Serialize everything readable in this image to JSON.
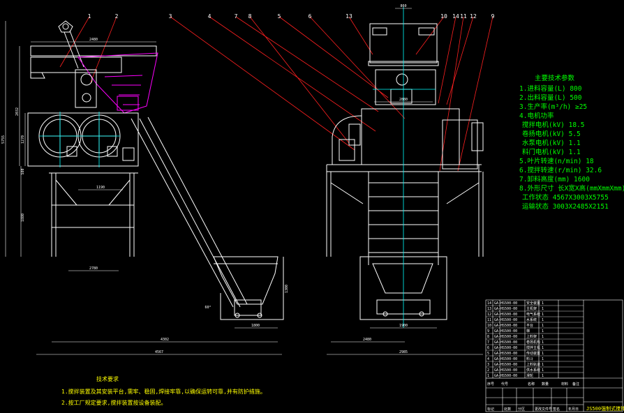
{
  "colors": {
    "background": "#000000",
    "outline": "#ffffff",
    "hidden": "#00ffff",
    "leader": "#ff2020",
    "hopper": "#ff00ff",
    "dimension": "#ffffff",
    "spec_text": "#00ff00",
    "note_text": "#ffff00"
  },
  "balloons": [
    "1",
    "2",
    "3",
    "4",
    "7",
    "8",
    "5",
    "6",
    "13",
    "10",
    "14",
    "11",
    "12",
    "9"
  ],
  "dimensions": {
    "hopper_width": "2480",
    "height_total": "5755",
    "height_upper": "2032",
    "mixer_height": "1270",
    "base_height": "1880",
    "stand_gap": "580",
    "mixer_span": "1190",
    "leg_span": "2780",
    "skip_height": "1300",
    "skip_width": "1800",
    "front_width_a": "4302",
    "front_width_total": "4567",
    "side_top": "860",
    "side_mid": "2880",
    "side_frame": "1900",
    "side_base": "2480",
    "side_total": "2985",
    "angle_label": "60°"
  },
  "specs": {
    "title": "主要技术参数",
    "lines": [
      "1.进料容量(L)  800",
      "2.出料容量(L)  500",
      "3.生产率(m³/h)  ≥25",
      "4.电机功率",
      "搅拌电机(kV)  18.5",
      "卷扬电机(kV)  5.5",
      "水泵电机(kV)  1.1",
      "料门电机(kV)  1.1",
      "5.叶片转速(n/min)  18",
      "6.搅拌转速(r/min)  32.6",
      "7.卸料高度(mm)    1600",
      "8.外形尺寸 长X宽X高(mmXmmXmm)",
      "工作状态  4567X3003X5755",
      "运输状态  3003X2485X2151"
    ]
  },
  "notes": {
    "title": "技术要求",
    "lines": [
      "1.搅拌装置及其安装平台,需牢、稳固,焊接牢靠,以确保运转可靠,并有防护措施。",
      "2.按工厂规定要求,搅拌装置按设备装配。"
    ]
  },
  "title_block": {
    "drawing_title": "JS500强制式搅拌机总图",
    "headers": [
      "序号",
      "代号",
      "名称",
      "数量",
      "材料",
      "备注"
    ],
    "rows": [
      {
        "no": "14",
        "code": "GA-HS500-00",
        "name": "安全装置",
        "qty": "1"
      },
      {
        "no": "13",
        "code": "GA-HS500-00",
        "name": "主机架",
        "qty": "1"
      },
      {
        "no": "12",
        "code": "GA-HS500-00",
        "name": "电气系统",
        "qty": "1"
      },
      {
        "no": "11",
        "code": "GA-HS500-00",
        "name": "水系统",
        "qty": "1"
      },
      {
        "no": "10",
        "code": "GA-HS500-00",
        "name": "平台",
        "qty": "1"
      },
      {
        "no": "9",
        "code": "GA-HS500-00",
        "name": "梯",
        "qty": "1"
      },
      {
        "no": "8",
        "code": "GA-HS500-00",
        "name": "上料架",
        "qty": "1"
      },
      {
        "no": "7",
        "code": "GA-HS500-00",
        "name": "卷扬机构",
        "qty": "1"
      },
      {
        "no": "6",
        "code": "GA-HS500-00",
        "name": "搅拌主机",
        "qty": "1"
      },
      {
        "no": "5",
        "code": "GA-HS500-00",
        "name": "传动装置",
        "qty": "1"
      },
      {
        "no": "4",
        "code": "GA-HS500-00",
        "name": "料斗",
        "qty": "1"
      },
      {
        "no": "3",
        "code": "GA-HS500-00",
        "name": "上料轨道",
        "qty": "1"
      },
      {
        "no": "2",
        "code": "GA-HS500-00",
        "name": "供水系统",
        "qty": "1"
      },
      {
        "no": "1",
        "code": "GA-HS500-00",
        "name": "滑轮",
        "qty": "1"
      }
    ],
    "footer_cells": [
      "标记",
      "处数",
      "分区",
      "更改文件号",
      "签名",
      "年月日"
    ]
  }
}
